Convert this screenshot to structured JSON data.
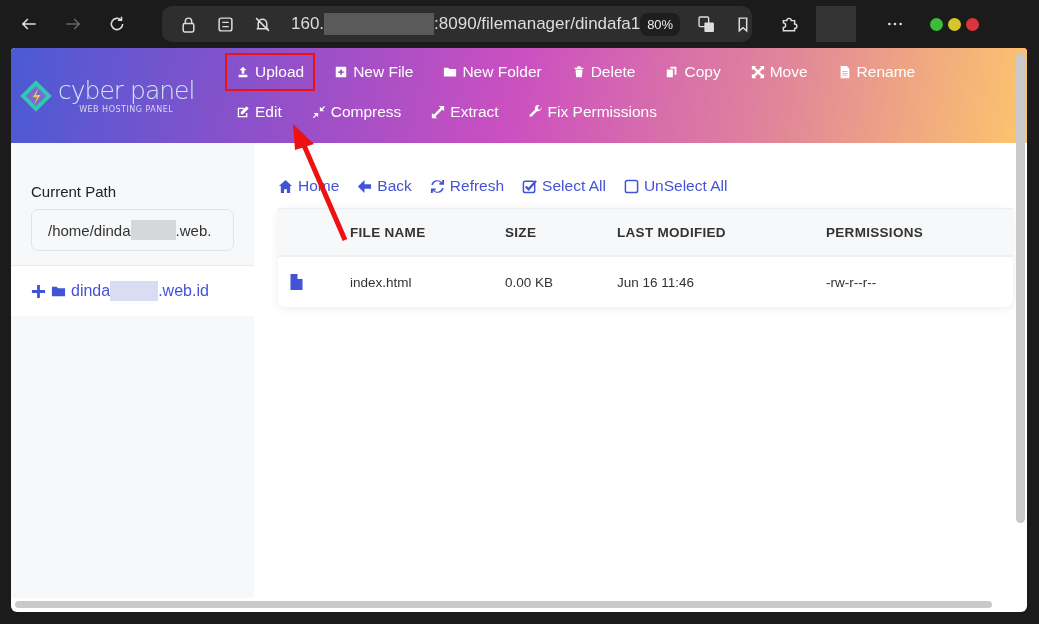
{
  "browser": {
    "url_start": "160.",
    "url_rest": ":8090/filemanager/dindafa1",
    "zoom": "80%"
  },
  "logo": {
    "name": "cyber panel",
    "tagline": "WEB HOSTING PANEL"
  },
  "toolbar": {
    "rows": [
      [
        {
          "label": "Upload",
          "highlighted": true
        },
        {
          "label": "New File",
          "highlighted": false
        },
        {
          "label": "New Folder",
          "highlighted": false
        },
        {
          "label": "Delete",
          "highlighted": false
        },
        {
          "label": "Copy",
          "highlighted": false
        },
        {
          "label": "Move",
          "highlighted": false
        },
        {
          "label": "Rename",
          "highlighted": false
        }
      ],
      [
        {
          "label": "Edit",
          "highlighted": false
        },
        {
          "label": "Compress",
          "highlighted": false
        },
        {
          "label": "Extract",
          "highlighted": false
        },
        {
          "label": "Fix Permissions",
          "highlighted": false
        }
      ]
    ]
  },
  "sidebar": {
    "path_label": "Current Path",
    "path_start": "/home/dinda",
    "path_end": ".web.",
    "tree": [
      {
        "name_start": "dinda",
        "name_end": ".web.id",
        "expanded": false
      }
    ]
  },
  "nav": [
    {
      "label": "Home"
    },
    {
      "label": "Back"
    },
    {
      "label": "Refresh"
    },
    {
      "label": "Select All"
    },
    {
      "label": "UnSelect All"
    }
  ],
  "table": {
    "columns": [
      "FILE NAME",
      "SIZE",
      "LAST MODIFIED",
      "PERMISSIONS"
    ],
    "rows": [
      {
        "kind": "file",
        "name": "index.html",
        "size": "0.00 KB",
        "modified": "Jun 16 11:46",
        "permissions": "-rw-r--r--"
      }
    ]
  }
}
